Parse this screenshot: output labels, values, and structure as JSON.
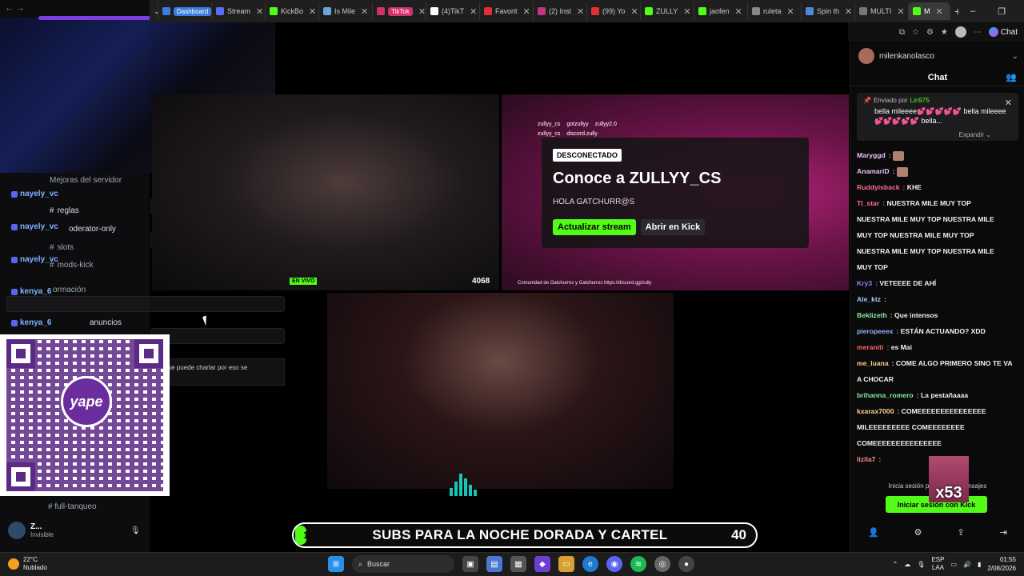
{
  "browser": {
    "tabs": [
      {
        "label": "Dashboard",
        "badge": true,
        "badge_color": "#3b7de0",
        "favicon": "#3b7de0"
      },
      {
        "label": "Stream",
        "favicon": "#5b6cff"
      },
      {
        "label": "KickBo",
        "favicon": "#53fc18"
      },
      {
        "label": "Is Mile",
        "favicon": "#6ba6d8"
      },
      {
        "label": "TikTok",
        "badge": true,
        "badge_color": "#d1306c",
        "favicon": "#d1306c"
      },
      {
        "label": "(4)TikT",
        "favicon": "#ffffff"
      },
      {
        "label": "Favorit",
        "favicon": "#e0302f"
      },
      {
        "label": "(2) Inst",
        "favicon": "#c13584"
      },
      {
        "label": "(99) Yo",
        "favicon": "#e0302f"
      },
      {
        "label": "ZULLY",
        "favicon": "#53fc18"
      },
      {
        "label": "jaofen",
        "favicon": "#53fc18"
      },
      {
        "label": "ruleta",
        "favicon": "#888888"
      },
      {
        "label": "Spin th",
        "favicon": "#4a8ae0"
      },
      {
        "label": "MULTI",
        "favicon": "#777777"
      },
      {
        "label": "M",
        "active": true,
        "favicon": "#53fc18"
      }
    ],
    "window_controls": [
      "–",
      "❐",
      "✕"
    ],
    "new_tab": "+",
    "toolbar": {
      "copilot_label": "Chat"
    }
  },
  "left_panel": {
    "channels": [
      {
        "text": "Mejoras del servidor"
      },
      {
        "text": "reglas"
      },
      {
        "text": "oderator-only"
      },
      {
        "text": "slots"
      },
      {
        "text": "mods-kick"
      },
      {
        "text": "ormación"
      },
      {
        "text": "anuncios"
      }
    ],
    "users": [
      "nayely_vc",
      "nayely_vc",
      "nayely_vc",
      "kenya_6",
      "kenya_6"
    ],
    "notice": "no se puede charlar por eso se",
    "bottom_channel": "full-tanqueo",
    "discord_user": {
      "name": "Z...",
      "status": "Invisible"
    }
  },
  "qr": {
    "brand": "yape",
    "brand_color": "#6b2d9e"
  },
  "offline_card": {
    "badge": "DESCONECTADO",
    "title": "Conoce a ZULLYY_CS",
    "subtitle": "HOLA GATCHURR@S",
    "primary_button": "Actualizar stream",
    "secondary_button": "Abrir en Kick"
  },
  "video_tr": {
    "socials": [
      "zullyy_cs",
      "gotzullyy",
      "zullyy2.0"
    ],
    "socials2": [
      "zullyy_cs",
      "discord.zully"
    ],
    "footer": "Comunidad de Gatchurros y Gatchurros  https://discord.gg/zully"
  },
  "video_tl": {
    "counter": "4068",
    "live_tag": "EN VIVO"
  },
  "sub_goal": {
    "text": "SUBS PARA LA NOCHE DORADA Y CARTEL",
    "count": "40",
    "progress": 0.02,
    "start_num": "1"
  },
  "chat": {
    "channel_user": "milenkanolasco",
    "title": "Chat",
    "pinned": {
      "by_prefix": "Enviado por",
      "by_user": "Lin975",
      "message": "bella mileeee💕💕💕💕💕 bella mileeee💕💕💕💕💕 bella...",
      "expand": "Expandir"
    },
    "messages": [
      {
        "user": "Maryggd",
        "color": "#f0c0ff",
        "text": "",
        "emote": true
      },
      {
        "user": "AnamariD",
        "color": "#f0c0ff",
        "text": "",
        "emote": true
      },
      {
        "user": "Ruddyisback",
        "color": "#ff6d9a",
        "text": "KHE"
      },
      {
        "user": "Tl_star",
        "color": "#ff6d9a",
        "text": "NUESTRA MILE MUY TOP"
      },
      {
        "user": "",
        "color": "#ffffff",
        "text": "NUESTRA MILE MUY TOP NUESTRA MILE"
      },
      {
        "user": "",
        "color": "#ffffff",
        "text": "MUY TOP NUESTRA MILE MUY TOP"
      },
      {
        "user": "",
        "color": "#ffffff",
        "text": "NUESTRA MILE MUY TOP NUESTRA MILE"
      },
      {
        "user": "",
        "color": "#ffffff",
        "text": "MUY TOP"
      },
      {
        "user": "Kry3",
        "color": "#9a7cff",
        "text": "VETEEEE DE AHÍ"
      },
      {
        "user": "Ale_ktz",
        "color": "#9fd0ff",
        "text": ""
      },
      {
        "user": "Beklizeth",
        "color": "#7ff0a0",
        "text": "Que intensos"
      },
      {
        "user": "pieropeeex",
        "color": "#8fb4ff",
        "text": "ESTÁN ACTUANDO? XDD"
      },
      {
        "user": "meraniti",
        "color": "#ff6060",
        "text": "es Mai"
      },
      {
        "user": "me_luana",
        "color": "#ffd08f",
        "text": "COME ALGO PRIMERO SINO TE VA"
      },
      {
        "user": "",
        "color": "#ffffff",
        "text": "A CHOCAR"
      },
      {
        "user": "brihanna_romero",
        "color": "#7ff0a0",
        "text": "La pestañaaaa"
      },
      {
        "user": "kxarax7000",
        "color": "#ffd08f",
        "text": "COMEEEEEEEEEEEEEEE"
      },
      {
        "user": "",
        "color": "#ffffff",
        "text": "MILEEEEEEEEE COMEEEEEEEE"
      },
      {
        "user": "",
        "color": "#ffffff",
        "text": "COMEEEEEEEEEEEEEEE"
      },
      {
        "user": "lizila7",
        "color": "#ff8a8a",
        "text": ""
      }
    ],
    "login_hint": "Inicia sesión para enviar mensajes",
    "login_button": "Iniciar sesión con Kick",
    "badge_overlay": "x53"
  },
  "taskbar": {
    "weather_temp": "22°C",
    "weather_desc": "Nublado",
    "search_placeholder": "Buscar",
    "lang": "ESP",
    "lang2": "LAA",
    "time": "01:55",
    "date": "2/08/2026"
  }
}
